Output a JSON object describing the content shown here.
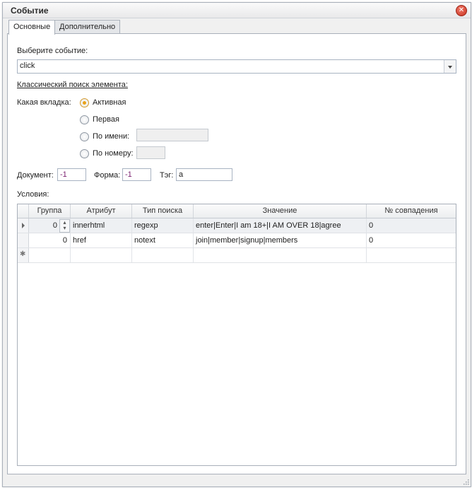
{
  "window": {
    "title": "Событие"
  },
  "tabs": [
    {
      "label": "Основные",
      "active": true
    },
    {
      "label": "Дополнительно",
      "active": false
    }
  ],
  "event": {
    "label": "Выберите событие:",
    "value": "click"
  },
  "search": {
    "heading": "Классический поиск элемента:",
    "tab_question": "Какая вкладка:",
    "options": [
      {
        "label": "Активная",
        "checked": true
      },
      {
        "label": "Первая",
        "checked": false
      },
      {
        "label": "По имени:",
        "checked": false,
        "value": ""
      },
      {
        "label": "По номеру:",
        "checked": false,
        "value": ""
      }
    ]
  },
  "params": {
    "document_label": "Документ:",
    "document_value": "-1",
    "form_label": "Форма:",
    "form_value": "-1",
    "tag_label": "Тэг:",
    "tag_value": "a"
  },
  "conditions": {
    "label": "Условия:",
    "columns": [
      "Группа",
      "Атрибут",
      "Тип поиска",
      "Значение",
      "№ совпадения"
    ],
    "rows": [
      {
        "group": "0",
        "attribute": "innerhtml",
        "search_type": "regexp",
        "value": "enter|Enter|I am 18+|I AM OVER 18|agree",
        "match": "0"
      },
      {
        "group": "0",
        "attribute": "href",
        "search_type": "notext",
        "value": "join|member|signup|members",
        "match": "0"
      }
    ]
  },
  "colors": {
    "accent_radio": "#e8a21b",
    "close_button": "#c9311f",
    "number_text": "#7a1e6e"
  }
}
